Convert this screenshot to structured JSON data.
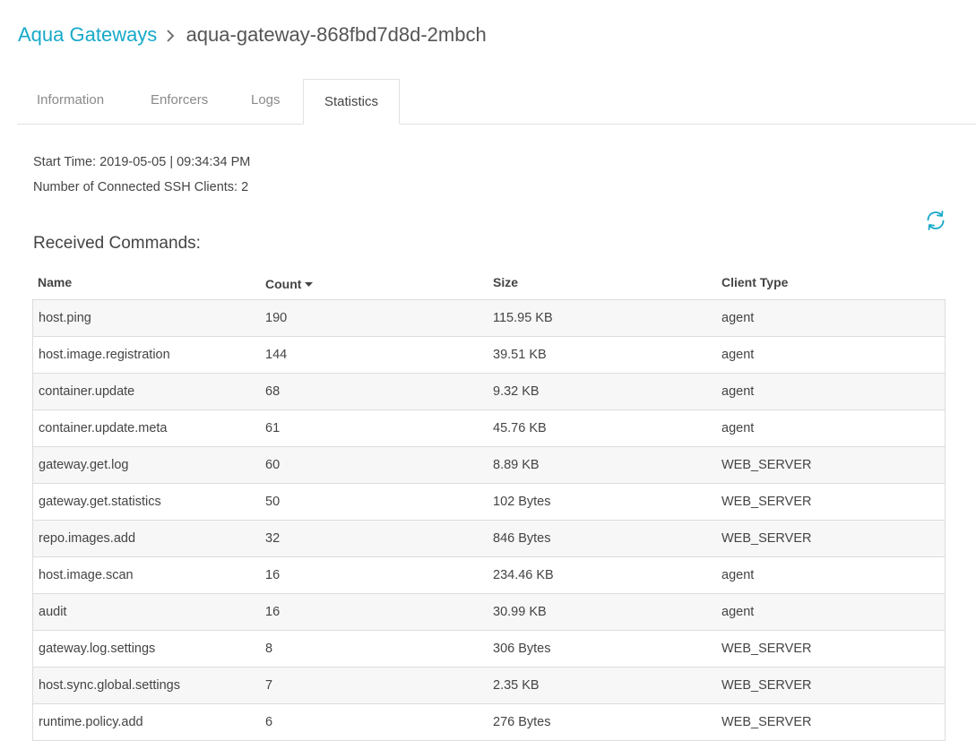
{
  "breadcrumb": {
    "parent": "Aqua Gateways",
    "current": "aqua-gateway-868fbd7d8d-2mbch"
  },
  "tabs": [
    {
      "label": "Information"
    },
    {
      "label": "Enforcers"
    },
    {
      "label": "Logs"
    },
    {
      "label": "Statistics",
      "active": true
    }
  ],
  "stats": {
    "start_time": "Start Time: 2019-05-05 | 09:34:34 PM",
    "ssh_clients": "Number of Connected SSH Clients: 2"
  },
  "received_commands": {
    "title": "Received Commands:",
    "columns": {
      "name": "Name",
      "count": "Count",
      "size": "Size",
      "client_type": "Client Type"
    },
    "rows": [
      {
        "name": "host.ping",
        "count": "190",
        "size": "115.95 KB",
        "client_type": "agent"
      },
      {
        "name": "host.image.registration",
        "count": "144",
        "size": "39.51 KB",
        "client_type": "agent"
      },
      {
        "name": "container.update",
        "count": "68",
        "size": "9.32 KB",
        "client_type": "agent"
      },
      {
        "name": "container.update.meta",
        "count": "61",
        "size": "45.76 KB",
        "client_type": "agent"
      },
      {
        "name": "gateway.get.log",
        "count": "60",
        "size": "8.89 KB",
        "client_type": "WEB_SERVER"
      },
      {
        "name": "gateway.get.statistics",
        "count": "50",
        "size": "102 Bytes",
        "client_type": "WEB_SERVER"
      },
      {
        "name": "repo.images.add",
        "count": "32",
        "size": "846 Bytes",
        "client_type": "WEB_SERVER"
      },
      {
        "name": "host.image.scan",
        "count": "16",
        "size": "234.46 KB",
        "client_type": "agent"
      },
      {
        "name": "audit",
        "count": "16",
        "size": "30.99 KB",
        "client_type": "agent"
      },
      {
        "name": "gateway.log.settings",
        "count": "8",
        "size": "306 Bytes",
        "client_type": "WEB_SERVER"
      },
      {
        "name": "host.sync.global.settings",
        "count": "7",
        "size": "2.35 KB",
        "client_type": "WEB_SERVER"
      },
      {
        "name": "runtime.policy.add",
        "count": "6",
        "size": "276 Bytes",
        "client_type": "WEB_SERVER"
      }
    ]
  },
  "icons": {
    "refresh": "refresh-icon",
    "sort": "sort-desc-caret-icon",
    "separator": "chevron-right-icon"
  },
  "colors": {
    "accent": "#17a9c9",
    "row_alt": "#f7f7f7",
    "border": "#dcdcdc"
  }
}
